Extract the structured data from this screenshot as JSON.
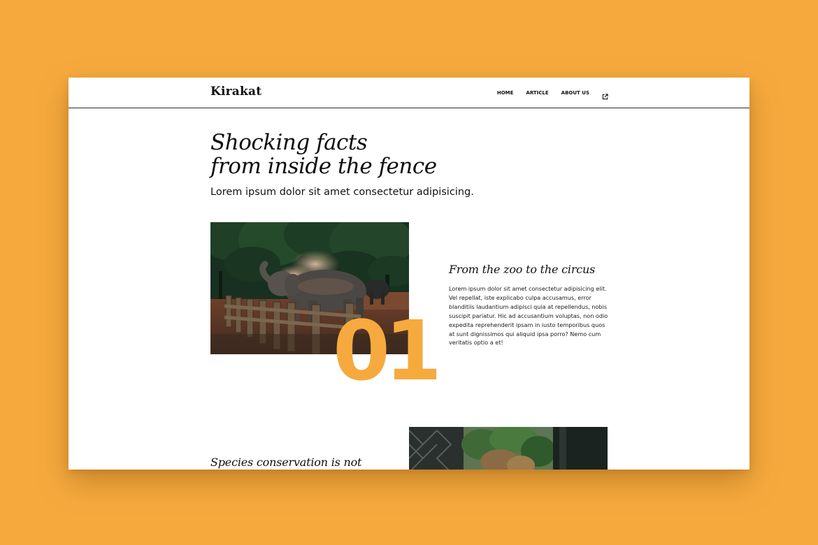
{
  "brand": {
    "logo": "Kirakat"
  },
  "nav": {
    "items": [
      {
        "label": "HOME"
      },
      {
        "label": "ARTICLE"
      },
      {
        "label": "ABOUT US"
      }
    ],
    "external_icon": "external-link-icon"
  },
  "hero": {
    "title_line1": "Shocking facts",
    "title_line2": "from inside the fence",
    "subtitle": "Lorem ipsum dolor sit amet consectetur adipisicing."
  },
  "articles": [
    {
      "number": "01",
      "title": "From the zoo to the circus",
      "body": "Lorem ipsum dolor sit amet consectetur adipisicing elit. Vel repellat, iste explicabo culpa accusamus, error blanditiis laudantium adipisci quia at repellendus, nobis suscipit pariatur. Hic ad accusantium voluptas, non odio expedita reprehenderit ipsam in iusto temporibus quos at sunt dignissimos qui aliquid ipsa porro? Nemo cum veritatis optio a et!",
      "image": "elephant-photo"
    },
    {
      "title": "Species conservation is not",
      "image": "trees-window-photo"
    }
  ],
  "colors": {
    "accent": "#F6AA3E",
    "text": "#111111",
    "background": "#FFFFFF"
  }
}
